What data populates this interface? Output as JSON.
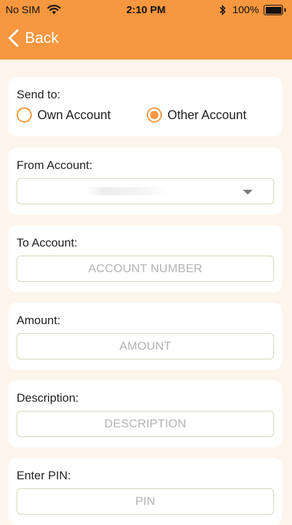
{
  "status_bar": {
    "carrier": "No SIM",
    "time": "2:10 PM",
    "battery": "100%"
  },
  "header": {
    "back_label": "Back"
  },
  "colors": {
    "accent": "#f7973f",
    "background": "#fdf4ec",
    "field_border": "#cfd8b8",
    "placeholder": "#b3b3b3"
  },
  "form": {
    "send_to": {
      "label": "Send to:",
      "options": [
        "Own Account",
        "Other Account"
      ],
      "selected": "Other Account"
    },
    "from_account": {
      "label": "From Account:",
      "value": ""
    },
    "to_account": {
      "label": "To Account:",
      "placeholder": "ACCOUNT NUMBER"
    },
    "amount": {
      "label": "Amount:",
      "placeholder": "AMOUNT"
    },
    "description": {
      "label": "Description:",
      "placeholder": "DESCRIPTION"
    },
    "pin": {
      "label": "Enter PIN:",
      "placeholder": "PIN"
    }
  }
}
